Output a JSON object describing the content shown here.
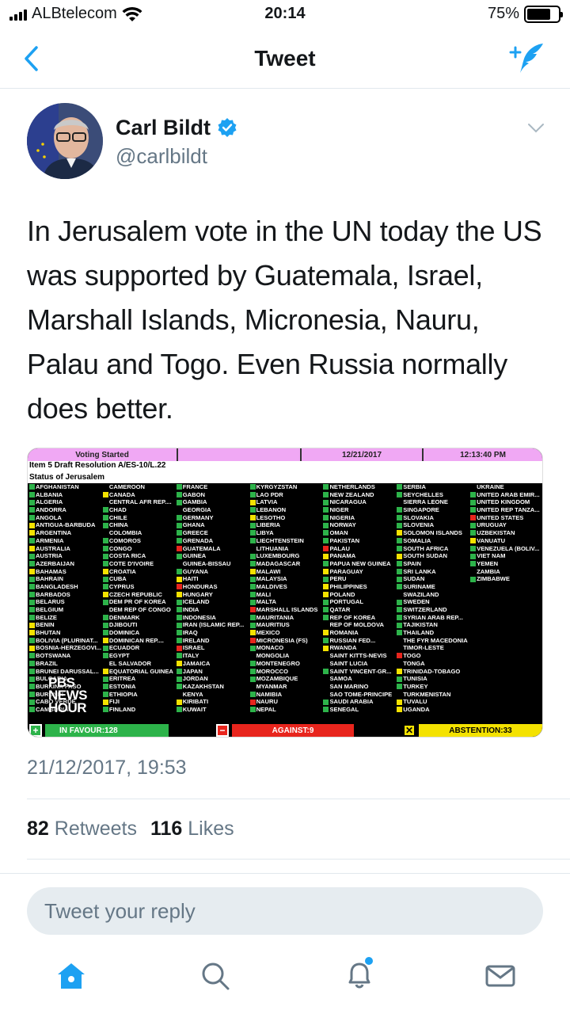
{
  "status_bar": {
    "carrier": "ALBtelecom",
    "time": "20:14",
    "battery": "75%",
    "battery_level": 0.75
  },
  "nav": {
    "title": "Tweet"
  },
  "tweet": {
    "author_name": "Carl Bildt",
    "author_handle": "@carlbildt",
    "text": "In Jerusalem vote in the UN today the US was supported by Guatemala, Israel, Marshall Islands,  Micronesia, Nauru, Palau and Togo. Even Russia normally does  better.",
    "timestamp": "21/12/2017, 19:53",
    "retweets_count": "82",
    "retweets_label": "Retweets",
    "likes_count": "116",
    "likes_label": "Likes"
  },
  "board": {
    "top_labels": [
      "Voting Started",
      "12/21/2017",
      "12:13:40 PM"
    ],
    "heading": "Item 5 Draft Resolution A/ES-10/L.22",
    "subheading": "Status of Jerusalem",
    "columns": [
      [
        "y|AFGHANISTAN",
        "y|ALBANIA",
        "y|ALGERIA",
        "y|ANDORRA",
        "y|ANGOLA",
        "a|ANTIGUA-BARBUDA",
        "a|ARGENTINA",
        "y|ARMENIA",
        "a|AUSTRALIA",
        "y|AUSTRIA",
        "y|AZERBAIJAN",
        "a|BAHAMAS",
        "y|BAHRAIN",
        "y|BANGLADESH",
        "y|BARBADOS",
        "y|BELARUS",
        "y|BELGIUM",
        "y|BELIZE",
        "a|BENIN",
        "a|BHUTAN",
        "y|BOLIVIA (PLURINAT...",
        "a|BOSNIA-HERZEGOVI...",
        "y|BOTSWANA",
        "y|BRAZIL",
        "y|BRUNEI DARUSSAL...",
        "y|BULGARIA",
        "y|BURKINA FASO",
        "y|BURUNDI",
        "y|CABO VERDE",
        "y|CAMBODIA"
      ],
      [
        "-|CAMEROON",
        "a|CANADA",
        "-|CENTRAL AFR REP....",
        "y|CHAD",
        "y|CHILE",
        "y|CHINA",
        "-|COLOMBIA",
        "y|COMOROS",
        "y|CONGO",
        "y|COSTA RICA",
        "y|COTE D'IVOIRE",
        "a|CROATIA",
        "y|CUBA",
        "y|CYPRUS",
        "a|CZECH REPUBLIC",
        "y|DEM PR OF KOREA",
        "-|DEM REP OF CONGO",
        "y|DENMARK",
        "y|DJIBOUTI",
        "y|DOMINICA",
        "a|DOMINICAN REP....",
        "y|ECUADOR",
        "y|EGYPT",
        "-|EL SALVADOR",
        "a|EQUATORIAL GUINEA",
        "y|ERITREA",
        "y|ESTONIA",
        "y|ETHIOPIA",
        "a|FIJI",
        "y|FINLAND"
      ],
      [
        "y|FRANCE",
        "y|GABON",
        "y|GAMBIA",
        "-|GEORGIA",
        "y|GERMANY",
        "y|GHANA",
        "y|GREECE",
        "y|GRENADA",
        "n|GUATEMALA",
        "y|GUINEA",
        "-|GUINEA-BISSAU",
        "y|GUYANA",
        "a|HAITI",
        "n|HONDURAS",
        "a|HUNGARY",
        "y|ICELAND",
        "y|INDIA",
        "y|INDONESIA",
        "y|IRAN (ISLAMIC REP...",
        "y|IRAQ",
        "y|IRELAND",
        "n|ISRAEL",
        "y|ITALY",
        "a|JAMAICA",
        "y|JAPAN",
        "y|JORDAN",
        "y|KAZAKHSTAN",
        "-|KENYA",
        "a|KIRIBATI",
        "y|KUWAIT"
      ],
      [
        "y|KYRGYZSTAN",
        "y|LAO PDR",
        "a|LATVIA",
        "y|LEBANON",
        "a|LESOTHO",
        "y|LIBERIA",
        "y|LIBYA",
        "y|LIECHTENSTEIN",
        "-|LITHUANIA",
        "y|LUXEMBOURG",
        "y|MADAGASCAR",
        "a|MALAWI",
        "y|MALAYSIA",
        "y|MALDIVES",
        "y|MALI",
        "y|MALTA",
        "n|MARSHALL ISLANDS",
        "y|MAURITANIA",
        "y|MAURITIUS",
        "a|MEXICO",
        "n|MICRONESIA (FS)",
        "y|MONACO",
        "-|MONGOLIA",
        "y|MONTENEGRO",
        "y|MOROCCO",
        "y|MOZAMBIQUE",
        "-|MYANMAR",
        "y|NAMIBIA",
        "n|NAURU",
        "y|NEPAL"
      ],
      [
        "y|NETHERLANDS",
        "y|NEW ZEALAND",
        "y|NICARAGUA",
        "y|NIGER",
        "y|NIGERIA",
        "y|NORWAY",
        "y|OMAN",
        "y|PAKISTAN",
        "n|PALAU",
        "a|PANAMA",
        "y|PAPUA NEW GUINEA",
        "a|PARAGUAY",
        "y|PERU",
        "a|PHILIPPINES",
        "a|POLAND",
        "y|PORTUGAL",
        "y|QATAR",
        "y|REP OF KOREA",
        "-|REP OF MOLDOVA",
        "a|ROMANIA",
        "y|RUSSIAN FED...",
        "a|RWANDA",
        "-|SAINT KITTS-NEVIS",
        "-|SAINT LUCIA",
        "y|SAINT VINCENT-GR...",
        "-|SAMOA",
        "-|SAN MARINO",
        "-|SAO TOME-PRINCIPE",
        "y|SAUDI ARABIA",
        "y|SENEGAL"
      ],
      [
        "y|SERBIA",
        "y|SEYCHELLES",
        "-|SIERRA LEONE",
        "y|SINGAPORE",
        "y|SLOVAKIA",
        "y|SLOVENIA",
        "a|SOLOMON ISLANDS",
        "y|SOMALIA",
        "y|SOUTH AFRICA",
        "a|SOUTH SUDAN",
        "y|SPAIN",
        "y|SRI LANKA",
        "y|SUDAN",
        "y|SURINAME",
        "-|SWAZILAND",
        "y|SWEDEN",
        "y|SWITZERLAND",
        "y|SYRIAN ARAB REP...",
        "y|TAJIKISTAN",
        "y|THAILAND",
        "-|THE FYR MACEDONIA",
        "-|TIMOR-LESTE",
        "n|TOGO",
        "-|TONGA",
        "a|TRINIDAD-TOBAGO",
        "y|TUNISIA",
        "y|TURKEY",
        "-|TURKMENISTAN",
        "a|TUVALU",
        "a|UGANDA"
      ],
      [
        "-|UKRAINE",
        "y|UNITED ARAB EMIR...",
        "y|UNITED KINGDOM",
        "y|UNITED REP TANZA...",
        "n|UNITED STATES",
        "y|URUGUAY",
        "y|UZBEKISTAN",
        "a|VANUATU",
        "y|VENEZUELA (BOLIV...",
        "y|VIET NAM",
        "y|YEMEN",
        "-|ZAMBIA",
        "y|ZIMBABWE"
      ]
    ],
    "overlay_brand": [
      "PBS",
      "NEWS",
      "HOUR"
    ],
    "tally": {
      "favour": "IN FAVOUR:128",
      "against": "AGAINST:9",
      "abstention": "ABSTENTION:33"
    }
  },
  "reply": {
    "placeholder": "Tweet your reply"
  },
  "tabbar": {
    "items": [
      "home-icon",
      "search-icon",
      "notifications-icon",
      "messages-icon"
    ]
  },
  "colors": {
    "accent": "#1da1f2",
    "text_secondary": "#657786",
    "favour": "#2db34a",
    "against": "#e8251d",
    "abstention": "#f4e200",
    "board_header": "#f0a8f4"
  }
}
